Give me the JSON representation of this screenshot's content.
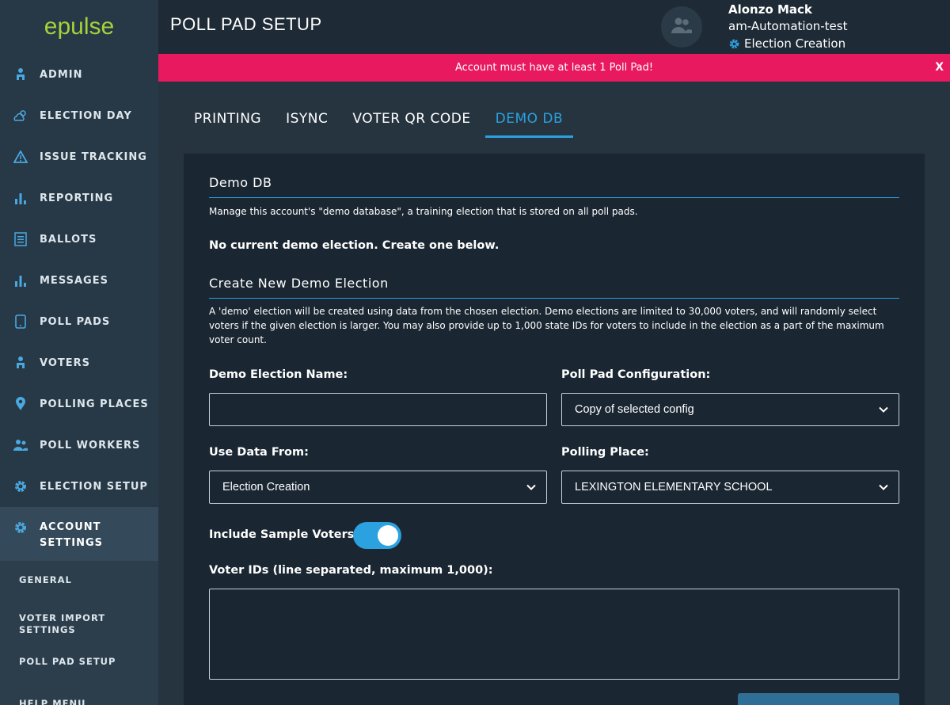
{
  "app": {
    "logo": "epulse"
  },
  "sidebar": {
    "items": [
      {
        "label": "ADMIN",
        "icon": "people-icon"
      },
      {
        "label": "ELECTION DAY",
        "icon": "cloud-sun-icon"
      },
      {
        "label": "ISSUE TRACKING",
        "icon": "warning-icon"
      },
      {
        "label": "REPORTING",
        "icon": "bar-chart-icon"
      },
      {
        "label": "BALLOTS",
        "icon": "ballot-icon"
      },
      {
        "label": "MESSAGES",
        "icon": "bar-chart-icon"
      },
      {
        "label": "POLL PADS",
        "icon": "tablet-icon"
      },
      {
        "label": "VOTERS",
        "icon": "people-icon"
      },
      {
        "label": "POLLING PLACES",
        "icon": "map-pin-icon"
      },
      {
        "label": "POLL WORKERS",
        "icon": "users-icon"
      },
      {
        "label": "ELECTION SETUP",
        "icon": "gear-icon"
      }
    ],
    "active": {
      "label": "ACCOUNT SETTINGS",
      "icon": "gear-icon"
    },
    "sub_items": [
      "GENERAL",
      "VOTER IMPORT SETTINGS",
      "POLL PAD SETUP",
      "HELP MENU"
    ]
  },
  "header": {
    "title": "POLL PAD SETUP",
    "user_name": "Alonzo Mack",
    "account": "am-Automation-test",
    "election": "Election Creation"
  },
  "alert": {
    "message": "Account must have at least 1 Poll Pad!",
    "close": "X"
  },
  "tabs": [
    {
      "label": "PRINTING"
    },
    {
      "label": "ISYNC"
    },
    {
      "label": "VOTER QR CODE"
    },
    {
      "label": "DEMO DB",
      "active": true
    }
  ],
  "demo_db": {
    "title": "Demo DB",
    "description": "Manage this account's \"demo database\", a training election that is stored on all poll pads.",
    "status": "No current demo election. Create one below."
  },
  "create": {
    "title": "Create New Demo Election",
    "description": "A 'demo' election will be created using data from the chosen election. Demo elections are limited to 30,000 voters, and will randomly select voters if the given election is larger. You may also provide up to 1,000 state IDs for voters to include in the election as a part of the maximum voter count.",
    "name_label": "Demo Election Name:",
    "name_value": "",
    "config_label": "Poll Pad Configuration:",
    "config_value": "Copy of selected config",
    "data_from_label": "Use Data From:",
    "data_from_value": "Election Creation",
    "polling_place_label": "Polling Place:",
    "polling_place_value": "LEXINGTON ELEMENTARY SCHOOL",
    "sample_voters_label": "Include Sample Voters",
    "sample_voters_on": true,
    "voter_ids_label": "Voter IDs (line separated, maximum 1,000):",
    "voter_ids_value": ""
  },
  "colors": {
    "accent": "#2ba1e0",
    "alert": "#e8195f",
    "logo": "#a6d23a"
  }
}
